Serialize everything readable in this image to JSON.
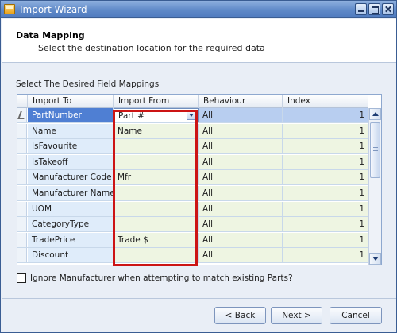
{
  "window": {
    "title": "Import Wizard"
  },
  "header": {
    "title": "Data Mapping",
    "subtitle": "Select the destination location for the required data"
  },
  "mapping": {
    "section_label": "Select The Desired Field Mappings",
    "columns": [
      "Import To",
      "Import From",
      "Behaviour",
      "Index"
    ],
    "rows": [
      {
        "to": "PartNumber",
        "from": "Part #",
        "behaviour": "All",
        "index": "1"
      },
      {
        "to": "Name",
        "from": "Name",
        "behaviour": "All",
        "index": "1"
      },
      {
        "to": "IsFavourite",
        "from": "",
        "behaviour": "All",
        "index": "1"
      },
      {
        "to": "IsTakeoff",
        "from": "",
        "behaviour": "All",
        "index": "1"
      },
      {
        "to": "Manufacturer Code",
        "from": "Mfr",
        "behaviour": "All",
        "index": "1"
      },
      {
        "to": "Manufacturer Name",
        "from": "",
        "behaviour": "All",
        "index": "1"
      },
      {
        "to": "UOM",
        "from": "",
        "behaviour": "All",
        "index": "1"
      },
      {
        "to": "CategoryType",
        "from": "",
        "behaviour": "All",
        "index": "1"
      },
      {
        "to": "TradePrice",
        "from": "Trade $",
        "behaviour": "All",
        "index": "1"
      },
      {
        "to": "Discount",
        "from": "",
        "behaviour": "All",
        "index": "1"
      }
    ],
    "selected_row": 0
  },
  "options": {
    "ignore_manufacturer_label": "Ignore Manufacturer when attempting to match existing Parts?",
    "ignore_manufacturer_checked": false
  },
  "buttons": {
    "back": "< Back",
    "next": "Next >",
    "cancel": "Cancel"
  },
  "icons": [
    "wizard-icon",
    "minimize-icon",
    "maximize-icon",
    "close-icon",
    "pencil-icon",
    "chevron-down-icon"
  ],
  "colors": {
    "highlight": "#cc1414",
    "selection": "#4f7fd3"
  }
}
